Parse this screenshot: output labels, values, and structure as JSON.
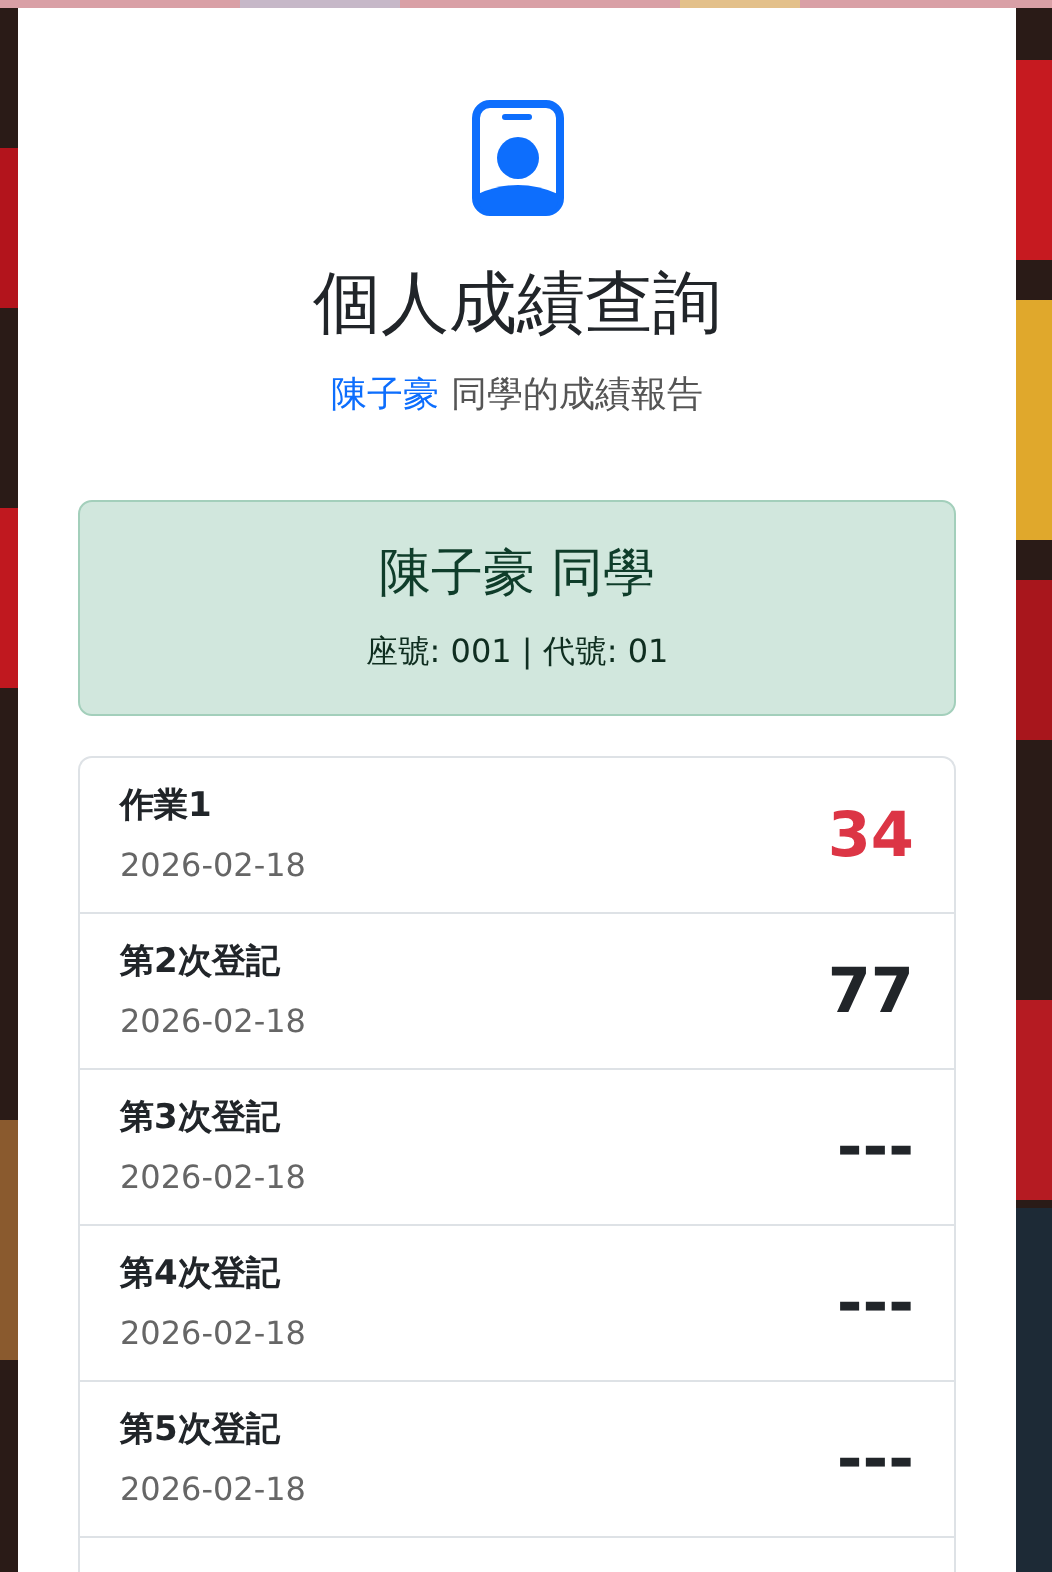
{
  "header": {
    "title": "個人成績查詢",
    "subtitle": {
      "name": "陳子豪",
      "text": " 同學的成績報告"
    }
  },
  "student": {
    "name": "陳子豪 同學",
    "info": "座號: 001 | 代號: 01"
  },
  "scores": [
    {
      "title": "作業1",
      "date": "2026-02-18",
      "score": "34",
      "failing": true
    },
    {
      "title": "第2次登記",
      "date": "2026-02-18",
      "score": "77",
      "failing": false
    },
    {
      "title": "第3次登記",
      "date": "2026-02-18",
      "score": "---",
      "failing": false
    },
    {
      "title": "第4次登記",
      "date": "2026-02-18",
      "score": "---",
      "failing": false
    },
    {
      "title": "第5次登記",
      "date": "2026-02-18",
      "score": "---",
      "failing": false
    }
  ]
}
